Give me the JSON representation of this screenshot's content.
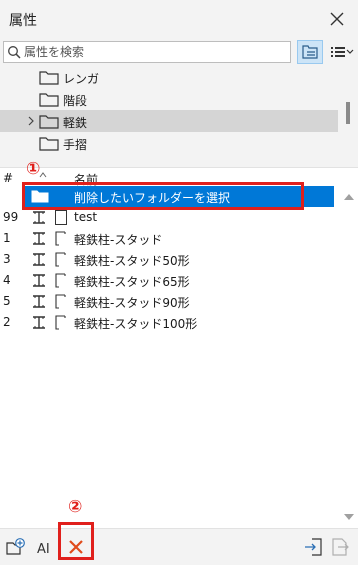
{
  "panel": {
    "title": "属性"
  },
  "search": {
    "placeholder": "属性を検索"
  },
  "tree": {
    "items": [
      {
        "label": "レンガ"
      },
      {
        "label": "階段"
      },
      {
        "label": "軽鉄"
      },
      {
        "label": "手摺"
      }
    ]
  },
  "table": {
    "columns": {
      "number": "#",
      "name": "名前"
    },
    "selected_row": {
      "label": "削除したいフォルダーを選択"
    },
    "rows": [
      {
        "count": "99",
        "name": "test"
      },
      {
        "count": "1",
        "name": "軽鉄柱-スタッド"
      },
      {
        "count": "3",
        "name": "軽鉄柱-スタッド50形"
      },
      {
        "count": "4",
        "name": "軽鉄柱-スタッド65形"
      },
      {
        "count": "5",
        "name": "軽鉄柱-スタッド90形"
      },
      {
        "count": "2",
        "name": "軽鉄柱-スタッド100形"
      }
    ]
  },
  "annotations": {
    "marker1": "①",
    "marker2": "②"
  },
  "toolbar": {
    "rename_glyph": "AI"
  },
  "colors": {
    "selection": "#0078d7",
    "annotation": "#e0201c",
    "view_button_active": "#cce4f7"
  }
}
